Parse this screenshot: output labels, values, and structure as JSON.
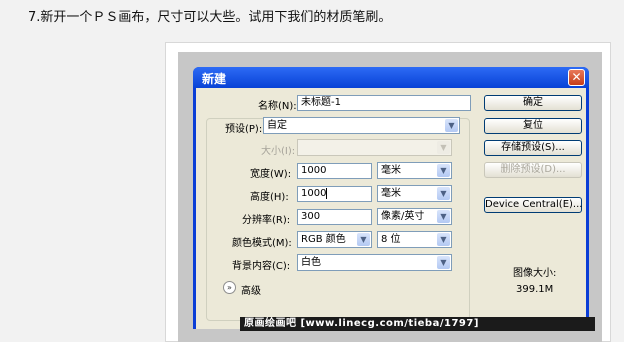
{
  "page": {
    "caption": "7.新开一个ＰＳ画布，尺寸可以大些。试用下我们的材质笔刷。"
  },
  "dialog": {
    "title": "新建",
    "close_glyph": "✕",
    "fields": {
      "name": {
        "label": "名称(N):",
        "value": "未标题-1"
      },
      "preset": {
        "label": "预设(P):",
        "value": "自定"
      },
      "size": {
        "label": "大小(I):",
        "value": ""
      },
      "width": {
        "label": "宽度(W):",
        "value": "1000",
        "unit": "毫米"
      },
      "height": {
        "label": "高度(H):",
        "value": "1000",
        "unit": "毫米"
      },
      "resolution": {
        "label": "分辨率(R):",
        "value": "300",
        "unit": "像素/英寸"
      },
      "color_mode": {
        "label": "颜色模式(M):",
        "value": "RGB 颜色",
        "bits": "8 位"
      },
      "background": {
        "label": "背景内容(C):",
        "value": "白色"
      }
    },
    "advanced_label": "高级",
    "buttons": {
      "ok": "确定",
      "reset": "复位",
      "save_preset": "存储预设(S)...",
      "delete_preset": "删除预设(D)...",
      "device_central": "Device Central(E)..."
    },
    "image_size": {
      "label": "图像大小:",
      "value": "399.1M"
    }
  },
  "watermark": "原画绘画吧  [www.linecg.com/tieba/1797]",
  "icons": {
    "dropdown": "chevron-down-icon",
    "expand": "double-chevron-down-icon",
    "close": "close-icon"
  }
}
